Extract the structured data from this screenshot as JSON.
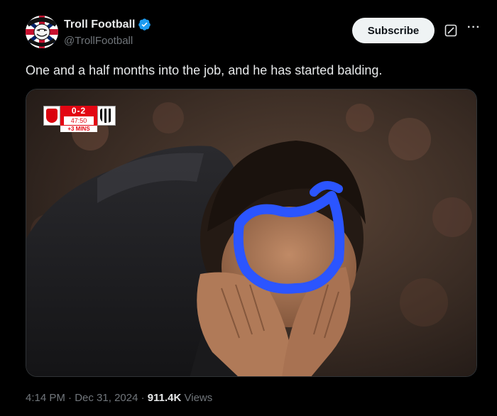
{
  "account": {
    "display_name": "Troll Football",
    "handle": "@TrollFootball",
    "avatar_icon": "troll-football-logo",
    "verified_icon": "verified-badge-icon",
    "verified_color": "#1d9bf0"
  },
  "actions": {
    "subscribe_label": "Subscribe",
    "grok_icon": "grok-icon",
    "more_label": "···"
  },
  "tweet": {
    "text": "One and a half months into the job, and he has started balding."
  },
  "media": {
    "scorebug": {
      "score": "0-2",
      "clock": "47:50",
      "added_time": "+3 MINS"
    },
    "annotation_color": "#2b55ff"
  },
  "meta": {
    "time": "4:14 PM",
    "separator": " · ",
    "date": "Dec 31, 2024",
    "views_count": "911.4K",
    "views_label": "Views"
  }
}
